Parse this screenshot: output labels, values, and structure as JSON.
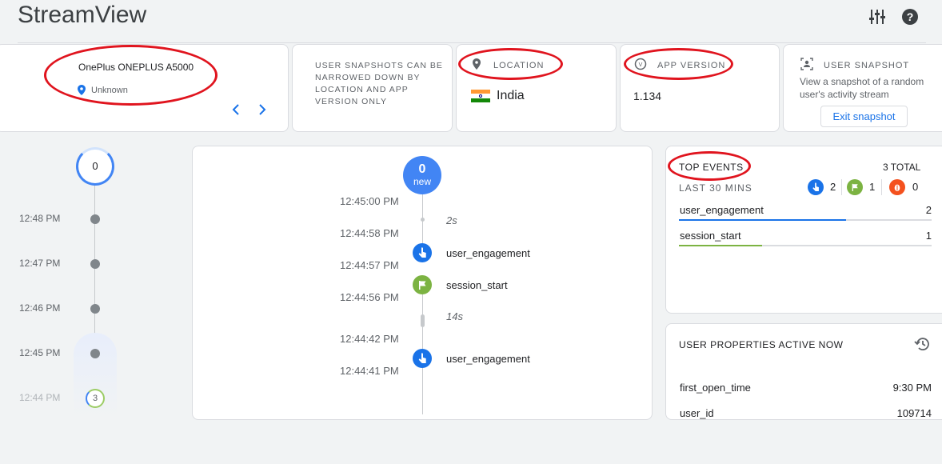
{
  "header": {
    "app_title": "StreamView"
  },
  "device_card": {
    "device_name": "OnePlus ONEPLUS A5000",
    "location": "Unknown"
  },
  "info_card": {
    "text": "USER SNAPSHOTS CAN BE NARROWED DOWN BY LOCATION AND APP VERSION ONLY"
  },
  "location_card": {
    "label": "LOCATION",
    "value": "India"
  },
  "version_card": {
    "label": "APP VERSION",
    "value": "1.134"
  },
  "snapshot_card": {
    "label": "USER SNAPSHOT",
    "description": "View a snapshot of a random user's activity stream",
    "exit_button": "Exit snapshot"
  },
  "left_timeline": {
    "top_count": "0",
    "times": [
      "12:48 PM",
      "12:47 PM",
      "12:46 PM",
      "12:45 PM",
      "12:44 PM"
    ],
    "last_count": "3"
  },
  "stream": {
    "new_count": "0",
    "new_label": "new",
    "times": [
      "12:45:00 PM",
      "12:44:58 PM",
      "12:44:57 PM",
      "12:44:56 PM",
      "12:44:42 PM",
      "12:44:41 PM"
    ],
    "gaps": [
      "2s",
      "14s"
    ],
    "events": [
      "user_engagement",
      "session_start",
      "user_engagement"
    ]
  },
  "top_events": {
    "title": "TOP EVENTS",
    "total": "3 TOTAL",
    "period": "LAST 30 MINS",
    "counts": {
      "engagement": "2",
      "conversion": "1",
      "error": "0"
    },
    "rows": [
      {
        "name": "user_engagement",
        "count": "2",
        "bar_fraction": 1.0,
        "color": "#1a73e8"
      },
      {
        "name": "session_start",
        "count": "1",
        "bar_fraction": 0.5,
        "color": "#7cb342"
      }
    ]
  },
  "user_properties": {
    "title": "USER PROPERTIES ACTIVE NOW",
    "rows": [
      {
        "name": "first_open_time",
        "value": "9:30 PM"
      },
      {
        "name": "user_id",
        "value": "109714"
      }
    ]
  },
  "colors": {
    "blue": "#1a73e8",
    "green": "#7cb342",
    "orange": "#f4511e",
    "annotation_red": "#e0141e"
  }
}
